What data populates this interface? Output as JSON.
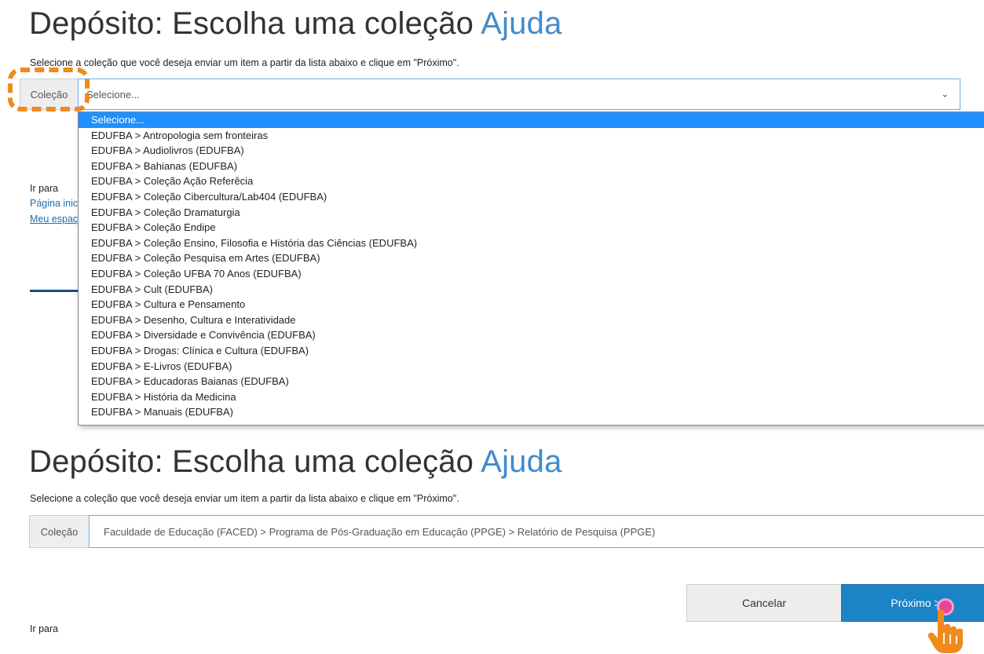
{
  "top": {
    "title_main": "Depósito: Escolha uma coleção ",
    "title_help": "Ajuda",
    "instruction": "Selecione a coleção que você deseja enviar um item a partir da lista abaixo e clique em \"Próximo\".",
    "collection_label": "Coleção",
    "select_value": "Selecione...",
    "goto_label": "Ir para",
    "link_home": "Página inicia",
    "link_myspace": "Meu espaço"
  },
  "dropdown": {
    "options": [
      "Selecione...",
      "EDUFBA > Antropologia sem fronteiras",
      "EDUFBA > Audiolivros (EDUFBA)",
      "EDUFBA > Bahianas (EDUFBA)",
      "EDUFBA > Coleção Ação Referêcia",
      "EDUFBA > Coleção Cibercultura/Lab404 (EDUFBA)",
      "EDUFBA > Coleção Dramaturgia",
      "EDUFBA > Coleção Endipe",
      "EDUFBA > Coleção Ensino, Filosofia e História das Ciências (EDUFBA)",
      "EDUFBA > Coleção Pesquisa em Artes (EDUFBA)",
      "EDUFBA > Coleção UFBA 70 Anos (EDUFBA)",
      "EDUFBA > Cult (EDUFBA)",
      "EDUFBA > Cultura e Pensamento",
      "EDUFBA > Desenho, Cultura e Interatividade",
      "EDUFBA > Diversidade e Convivência (EDUFBA)",
      "EDUFBA > Drogas: Clínica e Cultura (EDUFBA)",
      "EDUFBA > E-Livros (EDUFBA)",
      "EDUFBA > Educadoras Baianas (EDUFBA)",
      "EDUFBA > História da Medicina",
      "EDUFBA > Manuais (EDUFBA)"
    ],
    "selected_index": 0
  },
  "bottom": {
    "title_main": "Depósito: Escolha uma coleção ",
    "title_help": "Ajuda",
    "instruction": "Selecione a coleção que você deseja enviar um item a partir da lista abaixo e clique em \"Próximo\".",
    "collection_label": "Coleção",
    "select_value": "Faculdade de Educação (FACED) > Programa de Pós-Graduação em Educação (PPGE) > Relatório de Pesquisa (PPGE)",
    "cancel_label": "Cancelar",
    "next_label": "Próximo >",
    "goto_label": "Ir para"
  },
  "colors": {
    "highlight_ring": "#f08a1c",
    "help_link": "#428bca",
    "next_button": "#1a84c7",
    "dropdown_selected": "#1e90ff",
    "cursor_hand": "#f08a1c"
  },
  "icons": {
    "select_chevron": "chevron-down-icon",
    "pointer": "hand-pointer-icon"
  }
}
